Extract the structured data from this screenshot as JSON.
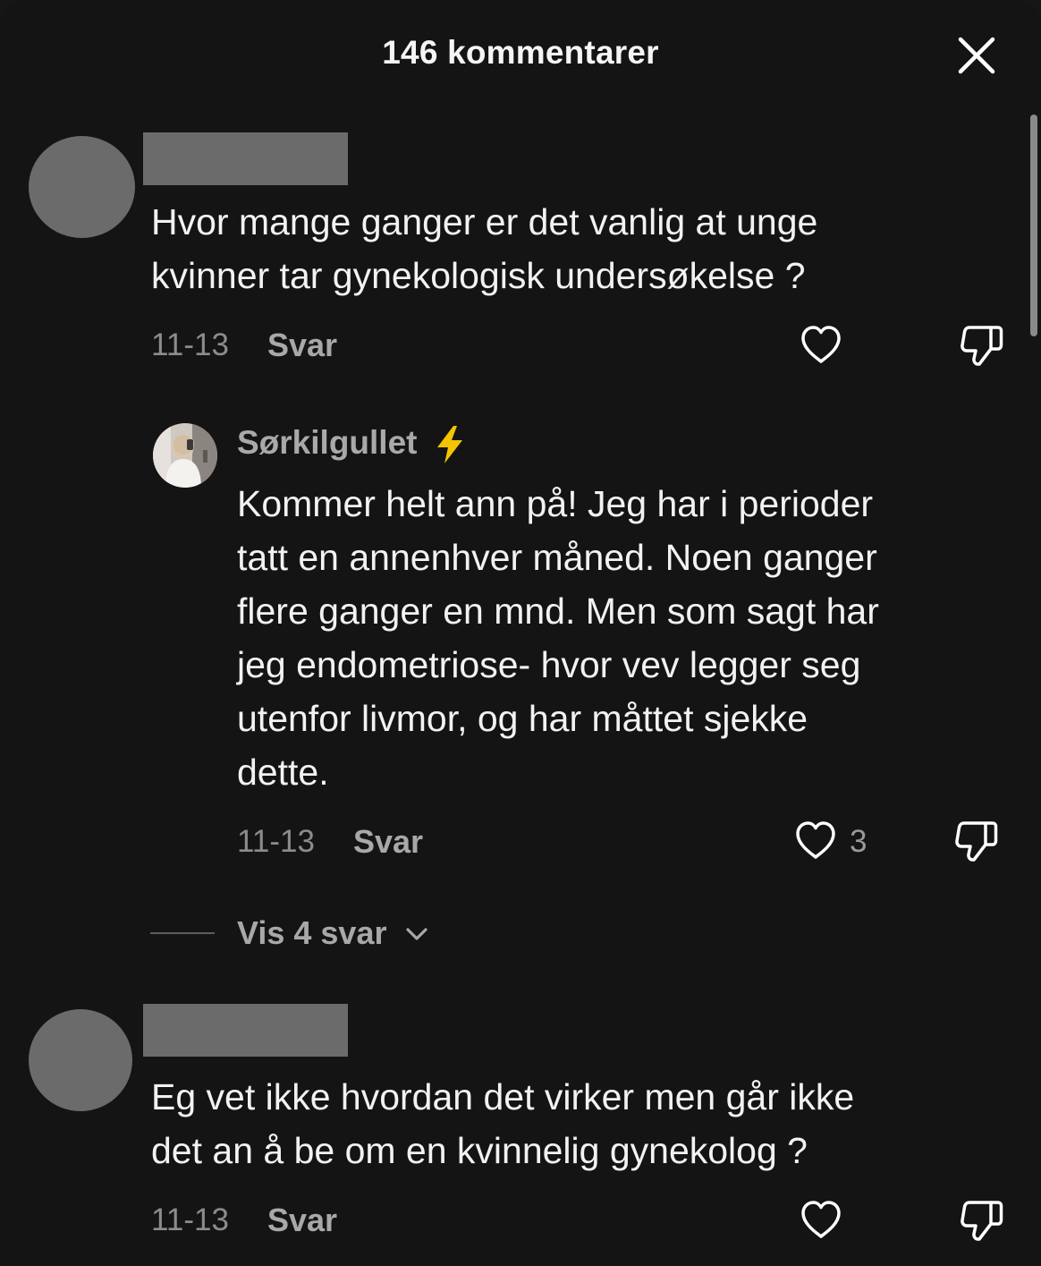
{
  "header": {
    "title": "146 kommentarer"
  },
  "comments": [
    {
      "text_lines": [
        "Hvor mange ganger er det vanlig at unge",
        "kvinner tar gynekologisk undersøkelse ?"
      ],
      "date": "11-13",
      "reply_label": "Svar",
      "replies": [
        {
          "author": "Sørkilgullet",
          "text_lines": [
            "Kommer helt ann på! Jeg har i perioder",
            "tatt en annenhver måned. Noen ganger",
            "flere ganger en mnd. Men som sagt har",
            "jeg endometriose- hvor vev legger seg",
            "utenfor livmor, og har måttet sjekke",
            "dette."
          ],
          "date": "11-13",
          "reply_label": "Svar",
          "like_count": "3"
        }
      ],
      "view_replies_label": "Vis 4 svar"
    },
    {
      "text_lines": [
        "Eg vet ikke hvordan det virker men går ikke",
        "det an å be om en kvinnelig gynekolog ?"
      ],
      "date": "11-13",
      "reply_label": "Svar"
    }
  ],
  "icons": {
    "close": "close-icon",
    "like": "heart-icon",
    "dislike": "thumbs-down-icon",
    "verified": "lightning-icon",
    "expand": "chevron-down-icon"
  },
  "colors": {
    "background": "#141414",
    "redacted": "#6b6b6b",
    "bolt": "#f5c400"
  }
}
